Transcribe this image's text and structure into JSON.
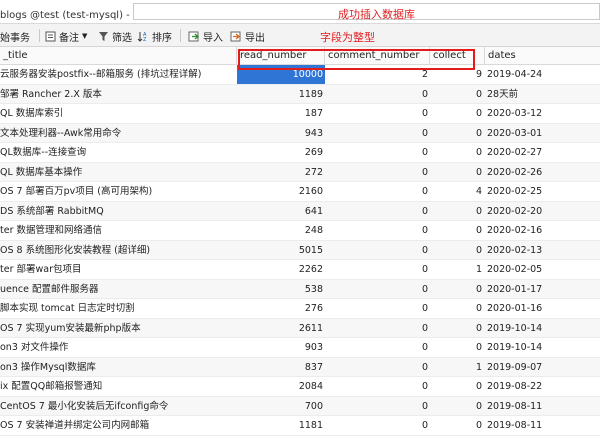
{
  "window": {
    "title": "blogs @test (test-mysql) - 表",
    "success_note": "成功插入数据库",
    "int_note": "字段为整型"
  },
  "toolbar": {
    "items": [
      "始事务",
      "备注",
      "筛选",
      "排序",
      "导入",
      "导出"
    ]
  },
  "table": {
    "columns": [
      "_title",
      "read_number",
      "comment_number",
      "collect",
      "dates"
    ],
    "rows": [
      [
        "云服务器安装postfix--邮箱服务 (排坑过程详解)",
        "10000",
        "2",
        "9",
        "2019-04-24"
      ],
      [
        "邹署 Rancher 2.X 版本",
        "1189",
        "0",
        "0",
        "28天前"
      ],
      [
        "QL 数据库索引",
        "187",
        "0",
        "0",
        "2020-03-12"
      ],
      [
        "文本处理利器--Awk常用命令",
        "943",
        "0",
        "0",
        "2020-03-01"
      ],
      [
        "QL数据库--连接查询",
        "269",
        "0",
        "0",
        "2020-02-27"
      ],
      [
        "QL 数据库基本操作",
        "272",
        "0",
        "0",
        "2020-02-26"
      ],
      [
        "OS 7 部署百万pv项目 (高可用架构)",
        "2160",
        "0",
        "4",
        "2020-02-25"
      ],
      [
        "DS 系统部署 RabbitMQ",
        "641",
        "0",
        "0",
        "2020-02-20"
      ],
      [
        "ter 数据管理和网络通信",
        "248",
        "0",
        "0",
        "2020-02-16"
      ],
      [
        "OS 8 系统图形化安装教程 (超详细)",
        "5015",
        "0",
        "0",
        "2020-02-13"
      ],
      [
        "ter 部署war包项目",
        "2262",
        "0",
        "1",
        "2020-02-05"
      ],
      [
        "uence 配置邮件服务器",
        "538",
        "0",
        "0",
        "2020-01-17"
      ],
      [
        "脚本实现 tomcat 日志定时切割",
        "276",
        "0",
        "0",
        "2020-01-16"
      ],
      [
        "OS 7 实现yum安装最新php版本",
        "2611",
        "0",
        "0",
        "2019-10-14"
      ],
      [
        "on3 对文件操作",
        "903",
        "0",
        "0",
        "2019-10-14"
      ],
      [
        "on3 操作Mysql数据库",
        "837",
        "0",
        "1",
        "2019-09-07"
      ],
      [
        "ix 配置QQ邮箱报警通知",
        "2084",
        "0",
        "0",
        "2019-08-22"
      ],
      [
        "CentOS 7 最小化安装后无ifconfig命令",
        "700",
        "0",
        "0",
        "2019-08-11"
      ],
      [
        "OS 7 安装禅道并绑定公司内网邮箱",
        "1181",
        "0",
        "0",
        "2019-08-11"
      ]
    ]
  },
  "colors": {
    "accent_red": "#e41b1b",
    "selection_blue": "#2f75d6"
  }
}
